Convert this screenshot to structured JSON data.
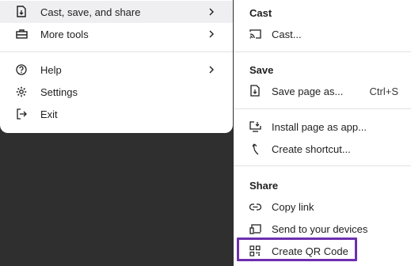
{
  "main_menu": {
    "items": [
      {
        "label": "Cast, save, and share",
        "icon": "cast-save-share-icon",
        "has_submenu": true
      },
      {
        "label": "More tools",
        "icon": "toolbox-icon",
        "has_submenu": true
      },
      {
        "label": "Help",
        "icon": "help-icon",
        "has_submenu": true
      },
      {
        "label": "Settings",
        "icon": "gear-icon",
        "has_submenu": false
      },
      {
        "label": "Exit",
        "icon": "exit-icon",
        "has_submenu": false
      }
    ]
  },
  "submenu": {
    "sections": [
      {
        "heading": "Cast",
        "items": [
          {
            "label": "Cast...",
            "icon": "cast-icon"
          }
        ]
      },
      {
        "heading": "Save",
        "items": [
          {
            "label": "Save page as...",
            "icon": "save-page-icon",
            "shortcut": "Ctrl+S"
          },
          {
            "label": "Install page as app...",
            "icon": "install-app-icon"
          },
          {
            "label": "Create shortcut...",
            "icon": "shortcut-icon"
          }
        ]
      },
      {
        "heading": "Share",
        "items": [
          {
            "label": "Copy link",
            "icon": "link-icon"
          },
          {
            "label": "Send to your devices",
            "icon": "devices-icon"
          },
          {
            "label": "Create QR Code",
            "icon": "qr-code-icon"
          }
        ]
      }
    ]
  },
  "colors": {
    "highlight_border": "#6e2fb0",
    "hover_bg": "#efeff2",
    "backdrop": "#2f2f2f"
  }
}
